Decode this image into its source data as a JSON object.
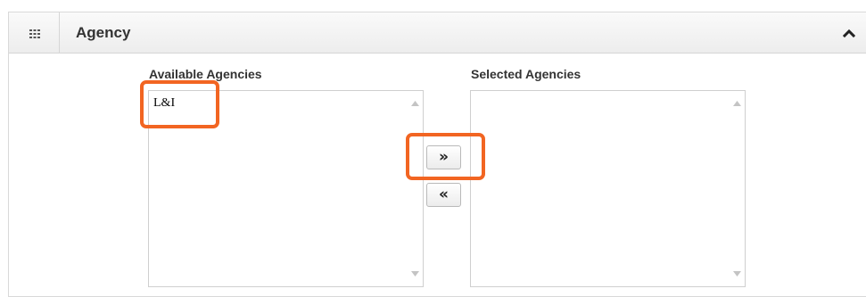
{
  "panel": {
    "title": "Agency",
    "icons": {
      "grid": "grid-icon",
      "collapse": "chevron-up-icon"
    }
  },
  "available": {
    "label": "Available Agencies",
    "options": [
      "L&I"
    ]
  },
  "selected": {
    "label": "Selected Agencies",
    "options": []
  },
  "buttons": {
    "add_label": "»",
    "remove_label": "«"
  },
  "colors": {
    "highlight": "#f26522",
    "header_bg": "#ededed",
    "border": "#d6d6d6"
  }
}
